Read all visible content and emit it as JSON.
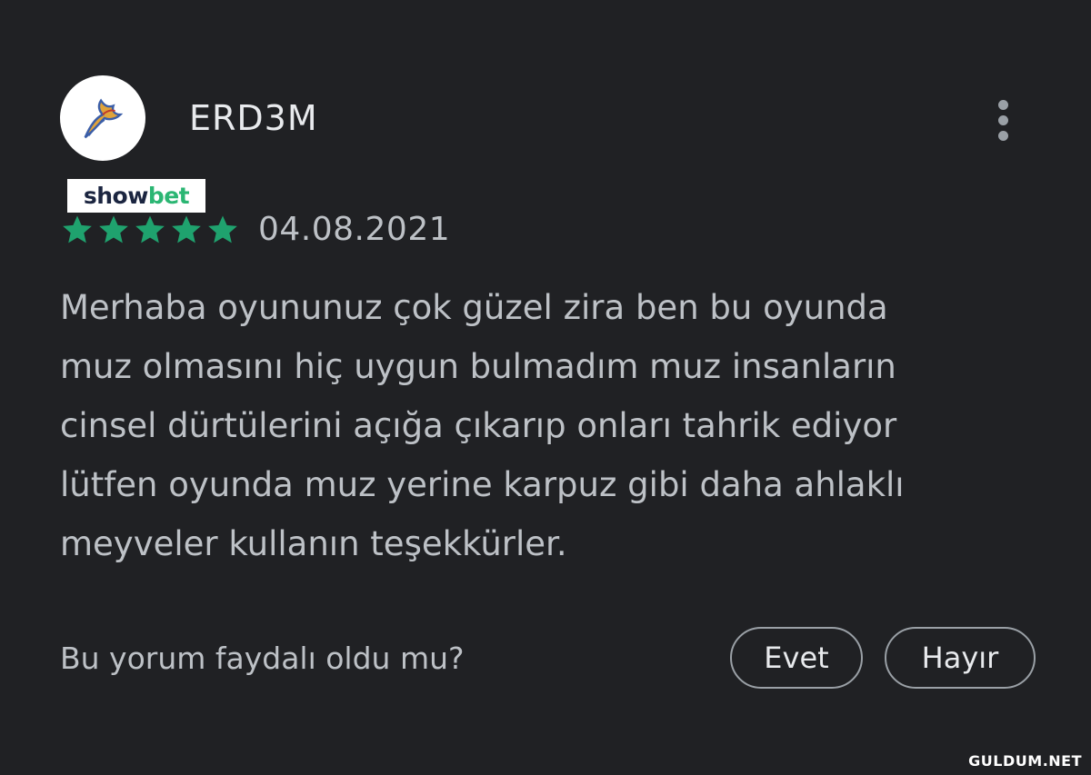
{
  "review": {
    "username": "ERD3M",
    "avatar_icon": "fairy-tail-emblem-icon",
    "rating": 5,
    "rating_max": 5,
    "date": "04.08.2021",
    "text_lines": [
      "Merhaba oyununuz çok güzel zira ben bu oyunda",
      "muz olmasını hiç uygun bulmadım muz insanların",
      "cinsel dürtülerini açığa çıkarıp onları tahrik ediyor",
      "lütfen oyunda muz yerine karpuz gibi daha ahlaklı",
      "meyveler kullanın teşekkürler."
    ],
    "menu_icon": "more-vert-icon"
  },
  "brand": {
    "part1": "show",
    "part2": "bet"
  },
  "feedback": {
    "question": "Bu yorum faydalı oldu mu?",
    "yes_label": "Evet",
    "no_label": "Hayır"
  },
  "watermark": "GULDUM.NET",
  "colors": {
    "background": "#202124",
    "star": "#1fa26e",
    "text": "#bdc1c6",
    "brand_dark": "#1b2540",
    "brand_green": "#2bb673"
  }
}
